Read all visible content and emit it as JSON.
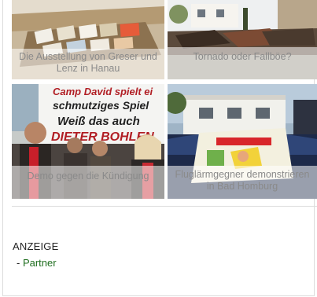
{
  "tiles": [
    {
      "caption": "Die Ausstellung von Greser und Lenz in Hanau"
    },
    {
      "caption": "Tornado oder Fallböe?"
    },
    {
      "caption": "Demo gegen die Kündigung"
    },
    {
      "caption": "Fluglärmgegner demonstrieren in Bad Homburg"
    }
  ],
  "banner": {
    "line1": "Camp David spielt ei",
    "line2": "schmutziges Spiel",
    "line3": "Weiß das auch",
    "line4": "DIETER BOHLEN"
  },
  "ad": {
    "label": "ANZEIGE",
    "dash": "- ",
    "partner_link": "Partner"
  }
}
